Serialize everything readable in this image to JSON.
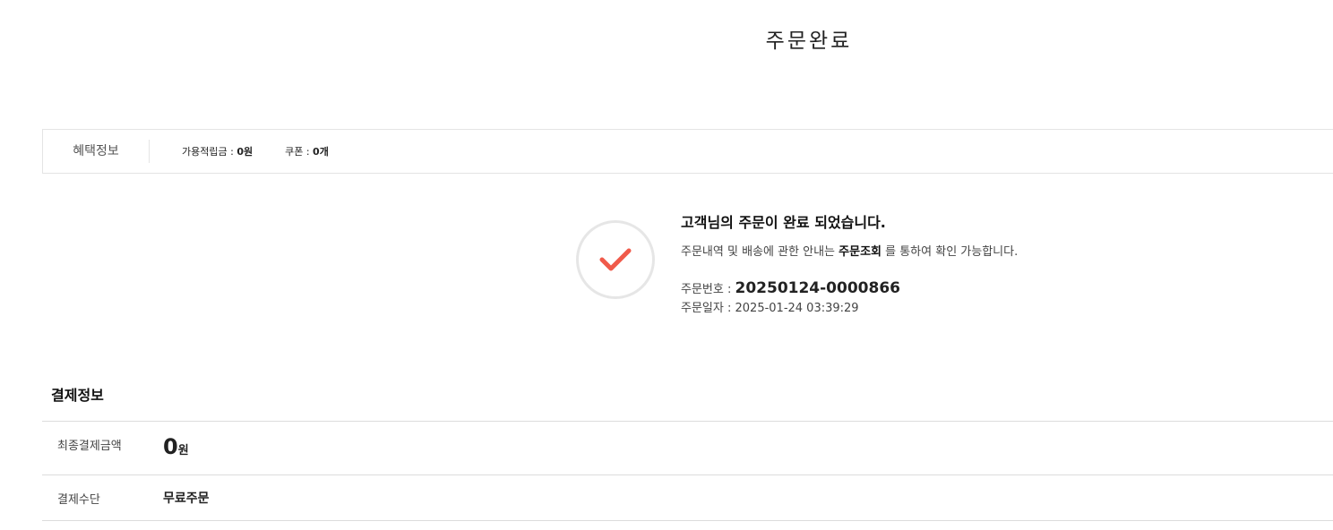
{
  "page_title": "주문완료",
  "benefit": {
    "title": "혜택정보",
    "points_label": "가용적립금 : ",
    "points_value": "0원",
    "coupon_label": "쿠폰 : ",
    "coupon_value": "0개"
  },
  "complete": {
    "icon": "check-icon",
    "accent_color": "#f05a4a",
    "heading": "고객님의 주문이 완료 되었습니다.",
    "desc_before": "주문내역 및 배송에 관한 안내는 ",
    "desc_bold": "주문조회",
    "desc_after": " 를 통하여 확인 가능합니다.",
    "order_no_label": "주문번호 : ",
    "order_no": "20250124-0000866",
    "order_date_label": "주문일자 : ",
    "order_date": "2025-01-24 03:39:29"
  },
  "payment": {
    "title": "결제정보",
    "final_amount_label": "최종결제금액",
    "final_amount": "0",
    "final_amount_unit": "원",
    "method_label": "결제수단",
    "method": "무료주문"
  }
}
